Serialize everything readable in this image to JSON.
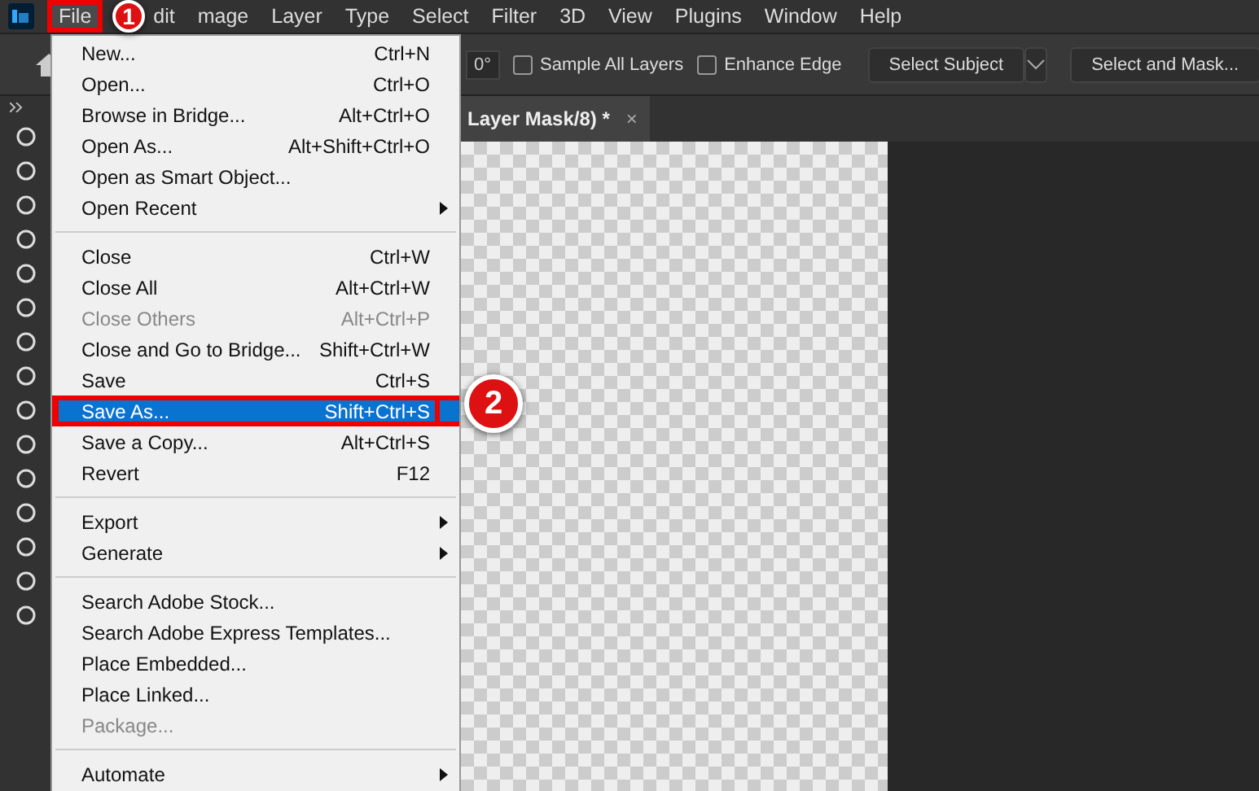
{
  "menubar": [
    {
      "label": "File",
      "selected": true
    },
    {
      "label": "dit",
      "selected": false
    },
    {
      "label": "mage",
      "selected": false
    },
    {
      "label": "Layer",
      "selected": false
    },
    {
      "label": "Type",
      "selected": false
    },
    {
      "label": "Select",
      "selected": false
    },
    {
      "label": "Filter",
      "selected": false
    },
    {
      "label": "3D",
      "selected": false
    },
    {
      "label": "View",
      "selected": false
    },
    {
      "label": "Plugins",
      "selected": false
    },
    {
      "label": "Window",
      "selected": false
    },
    {
      "label": "Help",
      "selected": false
    }
  ],
  "options_bar": {
    "angle": "0°",
    "checkboxes": [
      {
        "label": "Sample All Layers",
        "checked": false
      },
      {
        "label": "Enhance Edge",
        "checked": false
      }
    ],
    "buttons": [
      "Select Subject",
      "Select and Mask..."
    ]
  },
  "document_tab": {
    "title": "Layer Mask/8) *",
    "close": "×"
  },
  "file_menu": [
    {
      "kind": "item",
      "label": "New...",
      "shortcut": "Ctrl+N",
      "disabled": false,
      "selected": false,
      "submenu": false
    },
    {
      "kind": "item",
      "label": "Open...",
      "shortcut": "Ctrl+O",
      "disabled": false,
      "selected": false,
      "submenu": false
    },
    {
      "kind": "item",
      "label": "Browse in Bridge...",
      "shortcut": "Alt+Ctrl+O",
      "disabled": false,
      "selected": false,
      "submenu": false
    },
    {
      "kind": "item",
      "label": "Open As...",
      "shortcut": "Alt+Shift+Ctrl+O",
      "disabled": false,
      "selected": false,
      "submenu": false
    },
    {
      "kind": "item",
      "label": "Open as Smart Object...",
      "disabled": false,
      "selected": false,
      "submenu": false
    },
    {
      "kind": "item",
      "label": "Open Recent",
      "disabled": false,
      "selected": false,
      "submenu": true
    },
    {
      "kind": "separator"
    },
    {
      "kind": "item",
      "label": "Close",
      "shortcut": "Ctrl+W",
      "disabled": false,
      "selected": false,
      "submenu": false
    },
    {
      "kind": "item",
      "label": "Close All",
      "shortcut": "Alt+Ctrl+W",
      "disabled": false,
      "selected": false,
      "submenu": false
    },
    {
      "kind": "item",
      "label": "Close Others",
      "shortcut": "Alt+Ctrl+P",
      "disabled": true,
      "selected": false,
      "submenu": false
    },
    {
      "kind": "item",
      "label": "Close and Go to Bridge...",
      "shortcut": "Shift+Ctrl+W",
      "disabled": false,
      "selected": false,
      "submenu": false
    },
    {
      "kind": "item",
      "label": "Save",
      "shortcut": "Ctrl+S",
      "disabled": false,
      "selected": false,
      "submenu": false
    },
    {
      "kind": "item",
      "label": "Save As...",
      "shortcut": "Shift+Ctrl+S",
      "disabled": false,
      "selected": true,
      "submenu": false
    },
    {
      "kind": "item",
      "label": "Save a Copy...",
      "shortcut": "Alt+Ctrl+S",
      "disabled": false,
      "selected": false,
      "submenu": false
    },
    {
      "kind": "item",
      "label": "Revert",
      "shortcut": "F12",
      "disabled": false,
      "selected": false,
      "submenu": false
    },
    {
      "kind": "separator"
    },
    {
      "kind": "item",
      "label": "Export",
      "disabled": false,
      "selected": false,
      "submenu": true
    },
    {
      "kind": "item",
      "label": "Generate",
      "disabled": false,
      "selected": false,
      "submenu": true
    },
    {
      "kind": "separator"
    },
    {
      "kind": "item",
      "label": "Search Adobe Stock...",
      "disabled": false,
      "selected": false,
      "submenu": false
    },
    {
      "kind": "item",
      "label": "Search Adobe Express Templates...",
      "disabled": false,
      "selected": false,
      "submenu": false
    },
    {
      "kind": "item",
      "label": "Place Embedded...",
      "disabled": false,
      "selected": false,
      "submenu": false
    },
    {
      "kind": "item",
      "label": "Place Linked...",
      "disabled": false,
      "selected": false,
      "submenu": false
    },
    {
      "kind": "item",
      "label": "Package...",
      "disabled": true,
      "selected": false,
      "submenu": false
    },
    {
      "kind": "separator"
    },
    {
      "kind": "item",
      "label": "Automate",
      "disabled": false,
      "selected": false,
      "submenu": true
    }
  ],
  "annotations": [
    {
      "number": "1"
    },
    {
      "number": "2"
    }
  ]
}
